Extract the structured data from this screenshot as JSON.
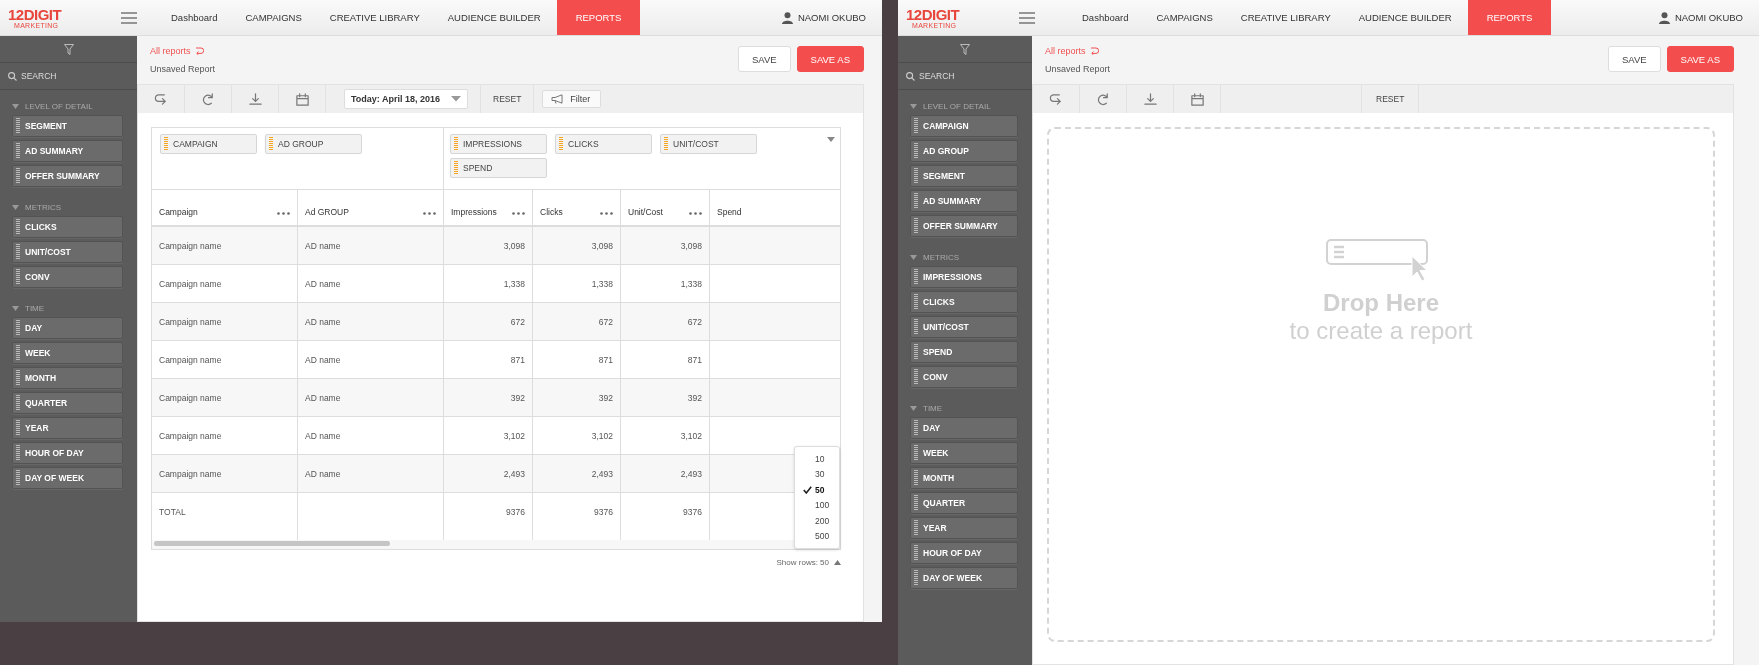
{
  "screens": [
    {
      "header": {
        "logo": "12DIGIT",
        "logo_sub": "MARKETING",
        "nav": [
          {
            "label": "Dashboard",
            "selected": false
          },
          {
            "label": "CAMPAIGNS",
            "selected": false
          },
          {
            "label": "CREATIVE LIBRARY",
            "selected": false
          },
          {
            "label": "AUDIENCE BUILDER",
            "selected": false
          },
          {
            "label": "REPORTS",
            "selected": true
          }
        ],
        "user": "NAOMI OKUBO"
      },
      "sidebar": {
        "search": {
          "placeholder": "SEARCH"
        },
        "groups": [
          {
            "title": "LEVEL OF DETAIL",
            "expanded": true,
            "items": [
              "SEGMENT",
              "AD SUMMARY",
              "OFFER SUMMARY"
            ]
          },
          {
            "title": "METRICS",
            "expanded": true,
            "items": [
              "CLICKS",
              "UNIT/COST",
              "CONV"
            ]
          },
          {
            "title": "TIME",
            "expanded": true,
            "items": [
              "DAY",
              "WEEK",
              "MONTH",
              "QUARTER",
              "YEAR",
              "HOUR OF DAY",
              "DAY OF WEEK"
            ]
          }
        ]
      },
      "report": {
        "breadcrumb": "All reports",
        "title": "Unsaved Report",
        "buttons": [
          {
            "label": "SAVE",
            "kind": "secondary"
          },
          {
            "label": "SAVE AS",
            "kind": "primary"
          }
        ],
        "toolbar": [
          {
            "kind": "undo"
          },
          {
            "kind": "redo"
          },
          {
            "kind": "download"
          },
          {
            "kind": "calendar"
          },
          {
            "kind": "date",
            "label": "Today: April 18, 2016"
          },
          {
            "kind": "reset",
            "label": "RESET"
          },
          {
            "kind": "filter",
            "label": "Filter"
          }
        ],
        "content": {
          "kind": "table",
          "row_fields": [
            "CAMPAIGN",
            "AD GROUP"
          ],
          "column_fields": [
            "IMPRESSIONS",
            "CLICKS",
            "UNIT/COST",
            "SPEND"
          ],
          "columns": [
            {
              "label": "Campaign",
              "kind": "text",
              "menu": true
            },
            {
              "label": "Ad GROUP",
              "kind": "text",
              "menu": true
            },
            {
              "label": "Impressions",
              "kind": "number",
              "menu": true
            },
            {
              "label": "Clicks",
              "kind": "number",
              "menu": true
            },
            {
              "label": "Unit/Cost",
              "kind": "number",
              "menu": true
            },
            {
              "label": "Spend",
              "kind": "number",
              "menu": false
            }
          ],
          "rows": [
            {
              "cells": [
                "Campaign name",
                "AD name",
                "3,098",
                "3,098",
                "3,098"
              ]
            },
            {
              "cells": [
                "Campaign name",
                "AD name",
                "1,338",
                "1,338",
                "1,338"
              ]
            },
            {
              "cells": [
                "Campaign name",
                "AD name",
                "672",
                "672",
                "672"
              ]
            },
            {
              "cells": [
                "Campaign name",
                "AD name",
                "871",
                "871",
                "871"
              ]
            },
            {
              "cells": [
                "Campaign name",
                "AD name",
                "392",
                "392",
                "392"
              ]
            },
            {
              "cells": [
                "Campaign name",
                "AD name",
                "3,102",
                "3,102",
                "3,102"
              ]
            },
            {
              "cells": [
                "Campaign name",
                "AD name",
                "2,493",
                "2,493",
                "2,493"
              ]
            }
          ],
          "total": {
            "label": "TOTAL",
            "values": [
              "9376",
              "9376",
              "9376"
            ]
          },
          "page_size": {
            "label": "Show rows: 50",
            "expanded": true,
            "options": [
              {
                "label": "10",
                "selected": false
              },
              {
                "label": "30",
                "selected": false
              },
              {
                "label": "50",
                "selected": true
              },
              {
                "label": "100",
                "selected": false
              },
              {
                "label": "200",
                "selected": false
              },
              {
                "label": "500",
                "selected": false
              }
            ]
          }
        }
      }
    },
    {
      "header": {
        "logo": "12DIGIT",
        "logo_sub": "MARKETING",
        "nav": [
          {
            "label": "Dashboard",
            "selected": false
          },
          {
            "label": "CAMPAIGNS",
            "selected": false
          },
          {
            "label": "CREATIVE LIBRARY",
            "selected": false
          },
          {
            "label": "AUDIENCE BUILDER",
            "selected": false
          },
          {
            "label": "REPORTS",
            "selected": true
          }
        ],
        "user": "NAOMI OKUBO"
      },
      "sidebar": {
        "search": {
          "placeholder": "SEARCH"
        },
        "groups": [
          {
            "title": "LEVEL OF DETAIL",
            "expanded": true,
            "items": [
              "CAMPAIGN",
              "AD GROUP",
              "SEGMENT",
              "AD SUMMARY",
              "OFFER SUMMARY"
            ]
          },
          {
            "title": "METRICS",
            "expanded": true,
            "items": [
              "IMPRESSIONS",
              "CLICKS",
              "UNIT/COST",
              "SPEND",
              "CONV"
            ]
          },
          {
            "title": "TIME",
            "expanded": true,
            "items": [
              "DAY",
              "WEEK",
              "MONTH",
              "QUARTER",
              "YEAR",
              "HOUR OF DAY",
              "DAY OF WEEK"
            ]
          }
        ]
      },
      "report": {
        "breadcrumb": "All reports",
        "title": "Unsaved Report",
        "buttons": [
          {
            "label": "SAVE",
            "kind": "secondary"
          },
          {
            "label": "SAVE AS",
            "kind": "primary"
          }
        ],
        "toolbar": [
          {
            "kind": "undo"
          },
          {
            "kind": "redo"
          },
          {
            "kind": "download"
          },
          {
            "kind": "calendar"
          },
          {
            "kind": "reset",
            "label": "RESET"
          }
        ],
        "content": {
          "kind": "dropzone",
          "title": "Drop Here",
          "subtitle": "to create a report"
        }
      }
    }
  ]
}
